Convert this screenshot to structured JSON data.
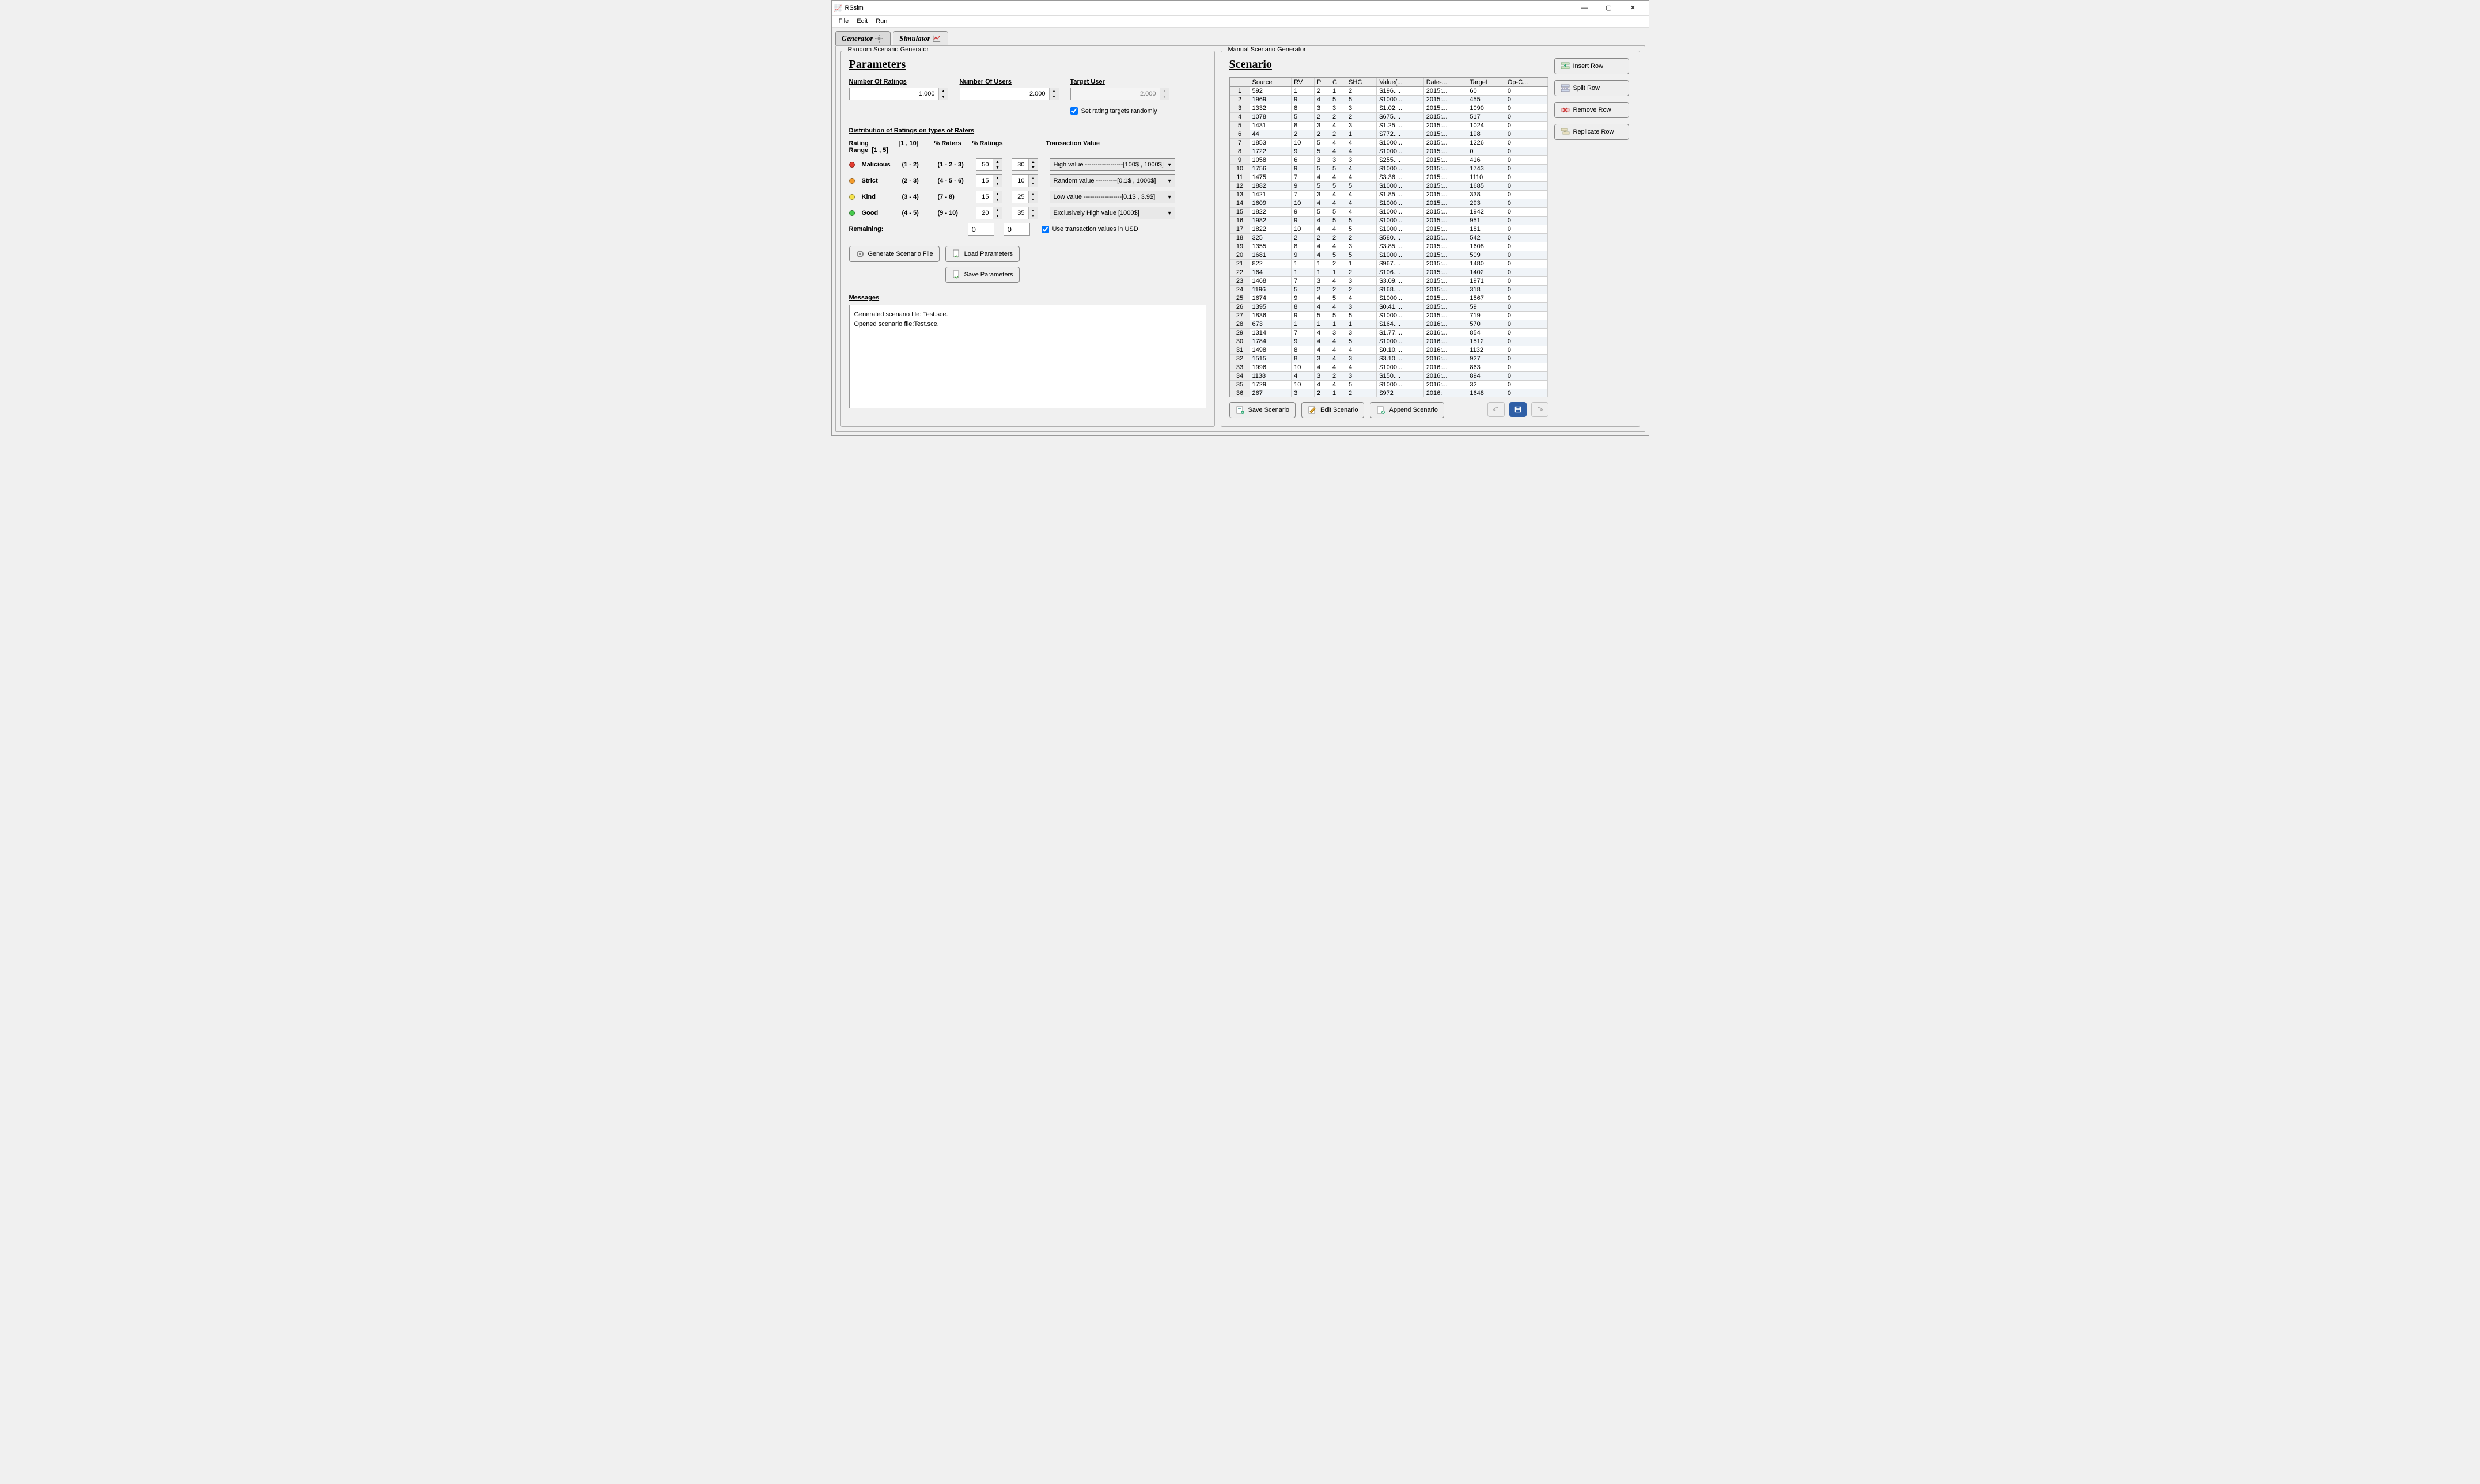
{
  "app": {
    "title": "RSsim"
  },
  "menubar": [
    "File",
    "Edit",
    "Run"
  ],
  "tabs": [
    {
      "label": "Generator",
      "active": true
    },
    {
      "label": "Simulator",
      "active": false
    }
  ],
  "left": {
    "group_label": "Random Scenario Generator",
    "title": "Parameters",
    "fields": {
      "num_ratings": {
        "label": "Number Of Ratings",
        "value": "1.000"
      },
      "num_users": {
        "label": "Number Of Users",
        "value": "2.000"
      },
      "target_user": {
        "label": "Target User",
        "value": "2.000",
        "disabled": true
      },
      "set_random": {
        "label": "Set rating targets randomly",
        "checked": true
      }
    },
    "distribution": {
      "title": "Distribution of Ratings on types of Raters",
      "head": {
        "range": "Rating Range",
        "r1_5": "[1 , 5]",
        "r1_10": "[1 , 10]",
        "pct_raters": "% Raters",
        "pct_ratings": "% Ratings",
        "trans_value": "Transaction Value"
      },
      "rows": [
        {
          "color": "#e33b2f",
          "name": "Malicious",
          "r15": "(1 - 2)",
          "r110": "(1 - 2 - 3)",
          "raters": "50",
          "ratings": "30",
          "trans": "High value ------------------[100$ , 1000$]"
        },
        {
          "color": "#f39b2a",
          "name": "Strict",
          "r15": "(2 - 3)",
          "r110": "(4 - 5 - 6)",
          "raters": "15",
          "ratings": "10",
          "trans": "Random value ----------[0.1$ , 1000$]"
        },
        {
          "color": "#f4e24b",
          "name": "Kind",
          "r15": "(3 - 4)",
          "r110": "(7 - 8)",
          "raters": "15",
          "ratings": "25",
          "trans": "Low value ------------------[0.1$ , 3.9$]"
        },
        {
          "color": "#47c94d",
          "name": "Good",
          "r15": "(4 - 5)",
          "r110": "(9 - 10)",
          "raters": "20",
          "ratings": "35",
          "trans": "Exclusively High value [1000$]"
        }
      ],
      "remaining_label": "Remaining:",
      "remaining_raters": "0",
      "remaining_ratings": "0",
      "use_usd": {
        "label": "Use transaction values in USD",
        "checked": true
      }
    },
    "buttons": {
      "generate": "Generate Scenario File",
      "load_params": "Load Parameters",
      "save_params": "Save Parameters"
    },
    "messages_label": "Messages",
    "messages": [
      "Generated scenario file: Test.sce.",
      "Opened scenario file:Test.sce."
    ]
  },
  "right": {
    "group_label": "Manual Scenario Generator",
    "title": "Scenario",
    "side_buttons": [
      "Insert Row",
      "Split Row",
      "Remove Row",
      "Replicate Row"
    ],
    "columns": [
      "",
      "Source",
      "RV",
      "P",
      "C",
      "SHC",
      "Value(...",
      "Date-...",
      "Target",
      "Op-C..."
    ],
    "rows": [
      {
        "n": 1,
        "src": "592",
        "rv": "1",
        "p": "2",
        "c": "1",
        "shc": "2",
        "val": "$196....",
        "date": "2015:...",
        "tgt": "60",
        "opc": "0"
      },
      {
        "n": 2,
        "src": "1969",
        "rv": "9",
        "p": "4",
        "c": "5",
        "shc": "5",
        "val": "$1000...",
        "date": "2015:...",
        "tgt": "455",
        "opc": "0"
      },
      {
        "n": 3,
        "src": "1332",
        "rv": "8",
        "p": "3",
        "c": "3",
        "shc": "3",
        "val": "$1.02....",
        "date": "2015:...",
        "tgt": "1090",
        "opc": "0"
      },
      {
        "n": 4,
        "src": "1078",
        "rv": "5",
        "p": "2",
        "c": "2",
        "shc": "2",
        "val": "$675....",
        "date": "2015:...",
        "tgt": "517",
        "opc": "0"
      },
      {
        "n": 5,
        "src": "1431",
        "rv": "8",
        "p": "3",
        "c": "4",
        "shc": "3",
        "val": "$1.25....",
        "date": "2015:...",
        "tgt": "1024",
        "opc": "0"
      },
      {
        "n": 6,
        "src": "44",
        "rv": "2",
        "p": "2",
        "c": "2",
        "shc": "1",
        "val": "$772....",
        "date": "2015:...",
        "tgt": "198",
        "opc": "0"
      },
      {
        "n": 7,
        "src": "1853",
        "rv": "10",
        "p": "5",
        "c": "4",
        "shc": "4",
        "val": "$1000...",
        "date": "2015:...",
        "tgt": "1226",
        "opc": "0"
      },
      {
        "n": 8,
        "src": "1722",
        "rv": "9",
        "p": "5",
        "c": "4",
        "shc": "4",
        "val": "$1000...",
        "date": "2015:...",
        "tgt": "0",
        "opc": "0"
      },
      {
        "n": 9,
        "src": "1058",
        "rv": "6",
        "p": "3",
        "c": "3",
        "shc": "3",
        "val": "$255....",
        "date": "2015:...",
        "tgt": "416",
        "opc": "0"
      },
      {
        "n": 10,
        "src": "1756",
        "rv": "9",
        "p": "5",
        "c": "5",
        "shc": "4",
        "val": "$1000...",
        "date": "2015:...",
        "tgt": "1743",
        "opc": "0"
      },
      {
        "n": 11,
        "src": "1475",
        "rv": "7",
        "p": "4",
        "c": "4",
        "shc": "4",
        "val": "$3.36....",
        "date": "2015:...",
        "tgt": "1110",
        "opc": "0"
      },
      {
        "n": 12,
        "src": "1882",
        "rv": "9",
        "p": "5",
        "c": "5",
        "shc": "5",
        "val": "$1000...",
        "date": "2015:...",
        "tgt": "1685",
        "opc": "0"
      },
      {
        "n": 13,
        "src": "1421",
        "rv": "7",
        "p": "3",
        "c": "4",
        "shc": "4",
        "val": "$1.85....",
        "date": "2015:...",
        "tgt": "338",
        "opc": "0"
      },
      {
        "n": 14,
        "src": "1609",
        "rv": "10",
        "p": "4",
        "c": "4",
        "shc": "4",
        "val": "$1000...",
        "date": "2015:...",
        "tgt": "293",
        "opc": "0"
      },
      {
        "n": 15,
        "src": "1822",
        "rv": "9",
        "p": "5",
        "c": "5",
        "shc": "4",
        "val": "$1000...",
        "date": "2015:...",
        "tgt": "1942",
        "opc": "0"
      },
      {
        "n": 16,
        "src": "1982",
        "rv": "9",
        "p": "4",
        "c": "5",
        "shc": "5",
        "val": "$1000...",
        "date": "2015:...",
        "tgt": "951",
        "opc": "0"
      },
      {
        "n": 17,
        "src": "1822",
        "rv": "10",
        "p": "4",
        "c": "4",
        "shc": "5",
        "val": "$1000...",
        "date": "2015:...",
        "tgt": "181",
        "opc": "0"
      },
      {
        "n": 18,
        "src": "325",
        "rv": "2",
        "p": "2",
        "c": "2",
        "shc": "2",
        "val": "$580....",
        "date": "2015:...",
        "tgt": "542",
        "opc": "0"
      },
      {
        "n": 19,
        "src": "1355",
        "rv": "8",
        "p": "4",
        "c": "4",
        "shc": "3",
        "val": "$3.85....",
        "date": "2015:...",
        "tgt": "1608",
        "opc": "0"
      },
      {
        "n": 20,
        "src": "1681",
        "rv": "9",
        "p": "4",
        "c": "5",
        "shc": "5",
        "val": "$1000...",
        "date": "2015:...",
        "tgt": "509",
        "opc": "0"
      },
      {
        "n": 21,
        "src": "822",
        "rv": "1",
        "p": "1",
        "c": "2",
        "shc": "1",
        "val": "$967....",
        "date": "2015:...",
        "tgt": "1480",
        "opc": "0"
      },
      {
        "n": 22,
        "src": "164",
        "rv": "1",
        "p": "1",
        "c": "1",
        "shc": "2",
        "val": "$106....",
        "date": "2015:...",
        "tgt": "1402",
        "opc": "0"
      },
      {
        "n": 23,
        "src": "1468",
        "rv": "7",
        "p": "3",
        "c": "4",
        "shc": "3",
        "val": "$3.09....",
        "date": "2015:...",
        "tgt": "1971",
        "opc": "0"
      },
      {
        "n": 24,
        "src": "1196",
        "rv": "5",
        "p": "2",
        "c": "2",
        "shc": "2",
        "val": "$168....",
        "date": "2015:...",
        "tgt": "318",
        "opc": "0"
      },
      {
        "n": 25,
        "src": "1674",
        "rv": "9",
        "p": "4",
        "c": "5",
        "shc": "4",
        "val": "$1000...",
        "date": "2015:...",
        "tgt": "1567",
        "opc": "0"
      },
      {
        "n": 26,
        "src": "1395",
        "rv": "8",
        "p": "4",
        "c": "4",
        "shc": "3",
        "val": "$0.41....",
        "date": "2015:...",
        "tgt": "59",
        "opc": "0"
      },
      {
        "n": 27,
        "src": "1836",
        "rv": "9",
        "p": "5",
        "c": "5",
        "shc": "5",
        "val": "$1000...",
        "date": "2015:...",
        "tgt": "719",
        "opc": "0"
      },
      {
        "n": 28,
        "src": "673",
        "rv": "1",
        "p": "1",
        "c": "1",
        "shc": "1",
        "val": "$164....",
        "date": "2016:...",
        "tgt": "570",
        "opc": "0"
      },
      {
        "n": 29,
        "src": "1314",
        "rv": "7",
        "p": "4",
        "c": "3",
        "shc": "3",
        "val": "$1.77....",
        "date": "2016:...",
        "tgt": "854",
        "opc": "0"
      },
      {
        "n": 30,
        "src": "1784",
        "rv": "9",
        "p": "4",
        "c": "4",
        "shc": "5",
        "val": "$1000...",
        "date": "2016:...",
        "tgt": "1512",
        "opc": "0"
      },
      {
        "n": 31,
        "src": "1498",
        "rv": "8",
        "p": "4",
        "c": "4",
        "shc": "4",
        "val": "$0.10....",
        "date": "2016:...",
        "tgt": "1132",
        "opc": "0"
      },
      {
        "n": 32,
        "src": "1515",
        "rv": "8",
        "p": "3",
        "c": "4",
        "shc": "3",
        "val": "$3.10....",
        "date": "2016:...",
        "tgt": "927",
        "opc": "0"
      },
      {
        "n": 33,
        "src": "1996",
        "rv": "10",
        "p": "4",
        "c": "4",
        "shc": "4",
        "val": "$1000...",
        "date": "2016:...",
        "tgt": "863",
        "opc": "0"
      },
      {
        "n": 34,
        "src": "1138",
        "rv": "4",
        "p": "3",
        "c": "2",
        "shc": "3",
        "val": "$150....",
        "date": "2016:...",
        "tgt": "894",
        "opc": "0"
      },
      {
        "n": 35,
        "src": "1729",
        "rv": "10",
        "p": "4",
        "c": "4",
        "shc": "5",
        "val": "$1000...",
        "date": "2016:...",
        "tgt": "32",
        "opc": "0"
      },
      {
        "n": 36,
        "src": "267",
        "rv": "3",
        "p": "2",
        "c": "1",
        "shc": "2",
        "val": "$972",
        "date": "2016:",
        "tgt": "1648",
        "opc": "0"
      }
    ],
    "bottom_buttons": [
      "Save Scenario",
      "Edit Scenario",
      "Append Scenario"
    ]
  }
}
